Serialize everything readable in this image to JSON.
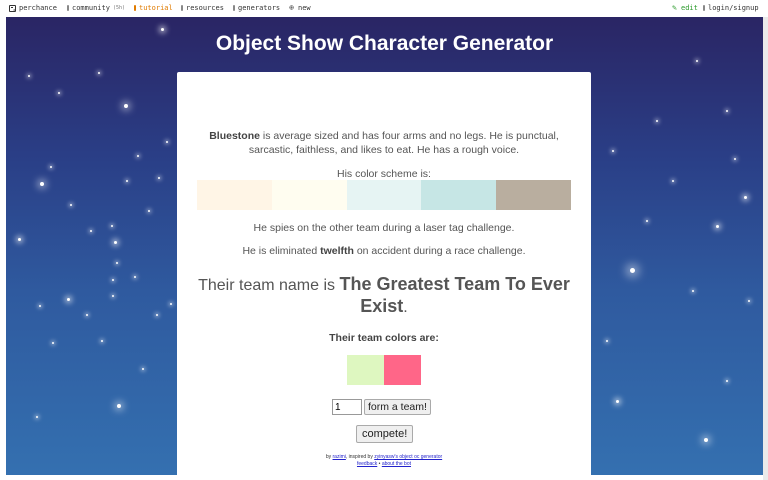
{
  "nav": {
    "perchance": "perchance",
    "community": "community",
    "community_count": "(5h)",
    "tutorial": "tutorial",
    "resources": "resources",
    "generators": "generators",
    "new": "new",
    "edit": "edit",
    "login": "login/signup"
  },
  "page": {
    "title": "Object Show Character Generator"
  },
  "character": {
    "name": "Bluestone",
    "description": "is average sized and has four arms and no legs. He is punctual, sarcastic, faithless, and likes to eat. He has a rough voice.",
    "scheme_label": "His color scheme is:",
    "scheme_colors": [
      "#fff5e6",
      "#fffdf0",
      "#e6f4f3",
      "#c6e6e5",
      "#b9ae9f"
    ],
    "spy_line": "He spies on the other team during a laser tag challenge.",
    "elim_prefix": "He is eliminated",
    "elim_place": "twelfth",
    "elim_suffix": "on accident during a race challenge."
  },
  "team": {
    "name_prefix": "Their team name is",
    "name": "The Greatest Team To Ever Exist",
    "name_suffix": ".",
    "colors_label": "Their team colors are:",
    "colors": [
      "#def7c0",
      "#ff6688"
    ]
  },
  "controls": {
    "team_count_value": "1",
    "form_team_label": "form a team!",
    "compete_label": "compete!"
  },
  "footer": {
    "by": "by",
    "author": "razimi",
    "inspired": ", inspired by",
    "inspired_link": "zyinyasw's object oc generator",
    "feedback": "feedback",
    "sep": "•",
    "about": "about the bot"
  }
}
